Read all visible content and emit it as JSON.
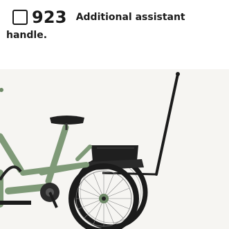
{
  "item": {
    "number": "923",
    "description_line1": "Additional assistant",
    "description_line2": "handle."
  },
  "colors": {
    "frame": "#7f9a78",
    "tyre": "#1b1b1b",
    "background": "#f6f5f2"
  },
  "icons": [
    "checkbox-icon"
  ]
}
